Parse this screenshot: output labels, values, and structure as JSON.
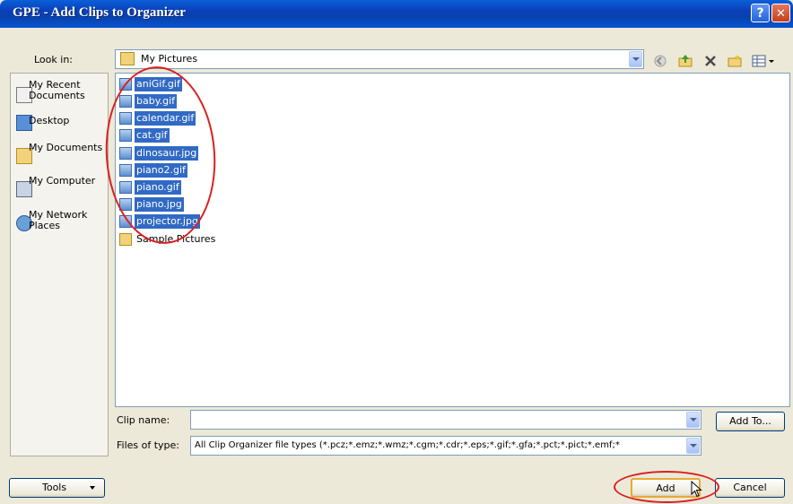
{
  "window": {
    "title": "GPE - Add Clips to Organizer",
    "help_label": "?",
    "close_label": "✕"
  },
  "look_in": {
    "label": "Look in:",
    "value": "My Pictures"
  },
  "places": [
    {
      "label": "My Recent Documents",
      "icon": "recent-documents-icon"
    },
    {
      "label": "Desktop",
      "icon": "desktop-icon"
    },
    {
      "label": "My Documents",
      "icon": "my-documents-icon"
    },
    {
      "label": "My Computer",
      "icon": "my-computer-icon"
    },
    {
      "label": "My Network Places",
      "icon": "network-places-icon"
    }
  ],
  "files": [
    {
      "name": "aniGif.gif",
      "selected": true
    },
    {
      "name": "baby.gif",
      "selected": true
    },
    {
      "name": "calendar.gif",
      "selected": true
    },
    {
      "name": "cat.gif",
      "selected": true
    },
    {
      "name": "dinosaur.jpg",
      "selected": true
    },
    {
      "name": "piano2.gif",
      "selected": true
    },
    {
      "name": "piano.gif",
      "selected": true
    },
    {
      "name": "piano.jpg",
      "selected": true
    },
    {
      "name": "projector.jpg",
      "selected": true
    },
    {
      "name": "Sample Pictures",
      "selected": false,
      "type": "folder"
    }
  ],
  "clip_name": {
    "label": "Clip name:",
    "value": ""
  },
  "files_of_type": {
    "label": "Files of type:",
    "value": "All Clip Organizer file types  (*.pcz;*.emz;*.wmz;*.cgm;*.cdr;*.eps;*.gif;*.gfa;*.pct;*.pict;*.emf;*"
  },
  "buttons": {
    "add_to": "Add To...",
    "tools": "Tools",
    "add": "Add",
    "cancel": "Cancel"
  },
  "colors": {
    "title_bar": "#0a3fb8",
    "selection": "#316ac5",
    "annotation": "#d92020"
  }
}
